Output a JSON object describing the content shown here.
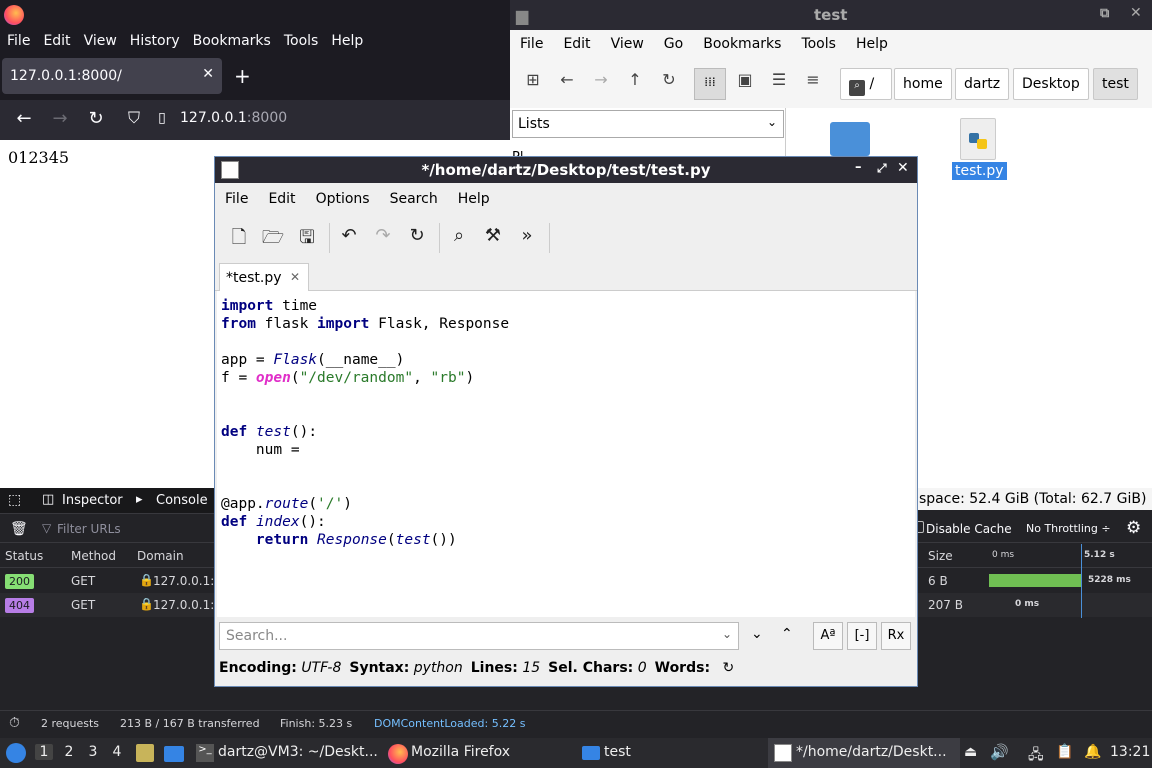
{
  "firefox": {
    "menu": [
      "File",
      "Edit",
      "View",
      "History",
      "Bookmarks",
      "Tools",
      "Help"
    ],
    "tab_label": "127.0.0.1:8000/",
    "url_host": "127.0.0.1",
    "url_port": ":8000",
    "page_text": "012345",
    "devtools": {
      "tabs": [
        "Inspector",
        "Console"
      ],
      "filter_placeholder": "Filter URLs",
      "disable_cache": "Disable Cache",
      "throttling": "No Throttling ÷",
      "columns": [
        "Status",
        "Method",
        "Domain",
        "Size"
      ],
      "timeline_ticks": [
        "0 ms",
        "5.12 s"
      ],
      "rows": [
        {
          "status": "200",
          "method": "GET",
          "domain": "127.0.0.1:8",
          "size": "6 B",
          "time": "5228 ms"
        },
        {
          "status": "404",
          "method": "GET",
          "domain": "127.0.0.1:8",
          "size": "207 B",
          "time": "0 ms"
        }
      ],
      "summary": {
        "requests": "2 requests",
        "transferred": "213 B / 167 B transferred",
        "finish": "Finish: 5.23 s",
        "dom": "DOMContentLoaded: 5.22 s"
      }
    }
  },
  "thunar": {
    "title": "test",
    "menu": [
      "File",
      "Edit",
      "View",
      "Go",
      "Bookmarks",
      "Tools",
      "Help"
    ],
    "crumbs": [
      "/",
      "home",
      "dartz",
      "Desktop",
      "test"
    ],
    "side_select": "Lists",
    "side_partial": "Pl",
    "file_label": "test.py",
    "free_space": "space: 52.4 GiB (Total: 62.7 GiB)"
  },
  "mousepad": {
    "title": "*/home/dartz/Desktop/test/test.py",
    "menu": [
      "File",
      "Edit",
      "Options",
      "Search",
      "Help"
    ],
    "tab_label": "*test.py",
    "search_placeholder": "Search...",
    "status": {
      "encoding_label": "Encoding:",
      "encoding": "UTF-8",
      "syntax_label": "Syntax:",
      "syntax": "python",
      "lines_label": "Lines:",
      "lines": "15",
      "sel_label": "Sel. Chars:",
      "sel": "0",
      "words_label": "Words:"
    },
    "code": {
      "l1_kw": "import",
      "l1_rest": " time",
      "l2_kw1": "from",
      "l2_mid": " flask ",
      "l2_kw2": "import",
      "l2_rest": " Flask, Response",
      "l4_a": "app = ",
      "l4_fn": "Flask",
      "l4_b": "(__name__)",
      "l5_a": "f = ",
      "l5_bi": "open",
      "l5_b": "(",
      "l5_s1": "\"/dev/random\"",
      "l5_c": ", ",
      "l5_s2": "\"rb\"",
      "l5_d": ")",
      "l8_kw": "def",
      "l8_sp": " ",
      "l8_fn": "test",
      "l8_rest": "():",
      "l9": "    num =",
      "l12_a": "@app.",
      "l12_fn": "route",
      "l12_b": "(",
      "l12_s": "'/'",
      "l12_c": ")",
      "l13_kw": "def",
      "l13_sp": " ",
      "l13_fn": "index",
      "l13_rest": "():",
      "l14_ind": "    ",
      "l14_kw": "return",
      "l14_sp": " ",
      "l14_fn1": "Response",
      "l14_b": "(",
      "l14_fn2": "test",
      "l14_c": "())"
    }
  },
  "taskbar": {
    "workspaces": [
      "1",
      "2",
      "3",
      "4"
    ],
    "terminal": "dartz@VM3: ~/Deskt...",
    "firefox": "Mozilla Firefox",
    "files": "test",
    "editor": "*/home/dartz/Deskt...",
    "clock": "13:21"
  }
}
